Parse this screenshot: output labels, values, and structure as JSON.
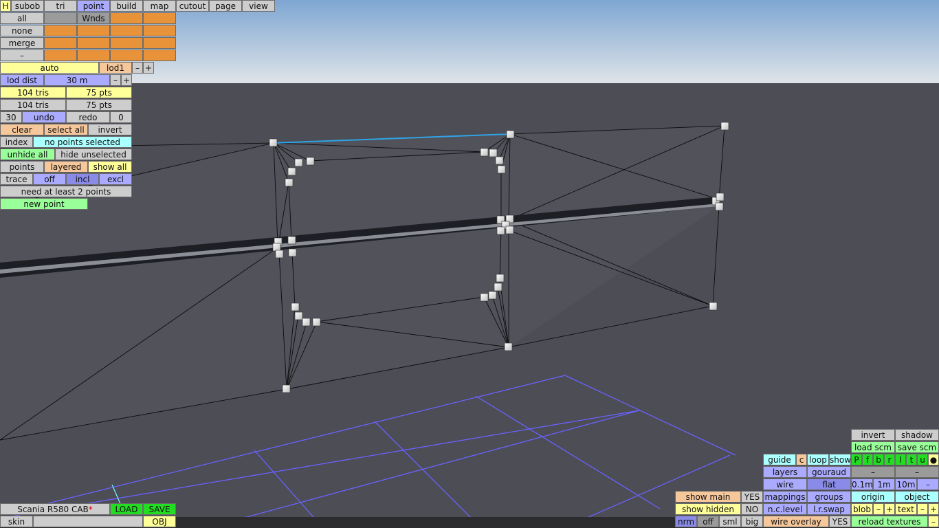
{
  "menubar": {
    "items": [
      "H",
      "subob",
      "tri",
      "point",
      "build",
      "map",
      "cutout",
      "page",
      "view"
    ],
    "active": "point"
  },
  "selection": {
    "all": "all",
    "none": "none",
    "merge": "merge",
    "minus": "–",
    "wnds": "Wnds"
  },
  "lod": {
    "auto": "auto",
    "level": "lod1",
    "minus": "–",
    "plus": "+",
    "dist_label": "lod dist",
    "dist_value": "30 m"
  },
  "stats": {
    "row1_tris": "104 tris",
    "row1_pts": "75 pts",
    "row2_tris": "104 tris",
    "row2_pts": "75 pts"
  },
  "history": {
    "count": "30",
    "undo": "undo",
    "redo": "redo",
    "redo_count": "0"
  },
  "edit": {
    "clear": "clear",
    "select_all": "select all",
    "invert": "invert"
  },
  "index": {
    "label": "index",
    "status": "no points selected"
  },
  "hide": {
    "unhide_all": "unhide all",
    "hide_unselected": "hide unselected"
  },
  "points_row": {
    "points": "points",
    "layered": "layered",
    "show_all": "show all"
  },
  "trace": {
    "label": "trace",
    "off": "off",
    "incl": "incl",
    "excl": "excl"
  },
  "message": "need at least 2 points",
  "new_point": "new point",
  "bottom_left": {
    "model_name": "Scania R580 CAB",
    "dirty_marker": "*",
    "load": "LOAD",
    "save": "SAVE",
    "skin": "skin",
    "obj": "OBJ"
  },
  "right_panel": {
    "invert": "invert",
    "shadow": "shadow",
    "load_scm": "load scm",
    "save_scm": "save scm",
    "guide": "guide",
    "c": "c",
    "loop": "loop",
    "show": "show",
    "flags": [
      "P",
      "f",
      "b",
      "r",
      "l",
      "t",
      "u",
      "●"
    ],
    "layers": "layers",
    "gouraud": "gouraud",
    "dash1": "–",
    "dash2": "–",
    "wire": "wire",
    "flat": "flat",
    "g01": "0.1m",
    "g1": "1m",
    "g10": "10m",
    "gminus": "–",
    "show_main": "show main",
    "show_main_val": "YES",
    "mappings": "mappings",
    "groups": "groups",
    "origin": "origin",
    "object": "object",
    "show_hidden": "show hidden",
    "show_hidden_val": "NO",
    "nc_level": "n.c.level",
    "lr_swap": "l.r.swap",
    "blob": "blob",
    "blob_minus": "–",
    "blob_plus": "+",
    "text": "text",
    "text_minus": "–",
    "text_plus": "+",
    "nrm": "nrm",
    "off": "off",
    "sml": "sml",
    "big": "big",
    "wire_overlay": "wire overlay",
    "wire_overlay_val": "YES",
    "reload_textures": "reload textures",
    "rt_minus": "–"
  },
  "colors": {
    "sky_top": "#7ea6d2",
    "sky_bottom": "#dfe4e8",
    "floor": "#4c4d55",
    "selected_edge": "#2fa4e6",
    "grid": "#6a62ff"
  }
}
